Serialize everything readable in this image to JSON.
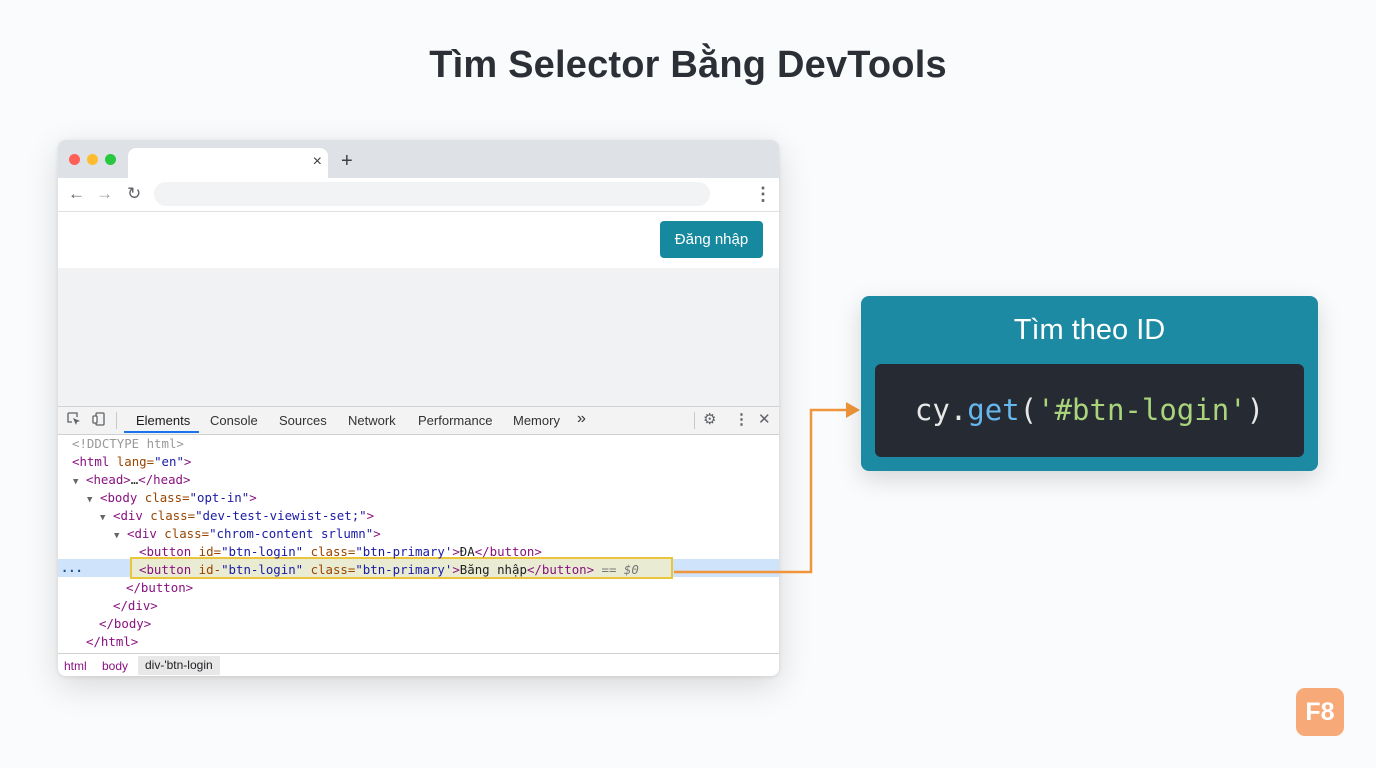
{
  "slide": {
    "title": "Tìm Selector Bằng DevTools"
  },
  "browser": {
    "tab_close_glyph": "×",
    "new_tab_glyph": "+",
    "back_glyph": "←",
    "forward_glyph": "→",
    "reload_glyph": "↻",
    "menu_glyph": "⋮",
    "login_button": "Đăng nhập"
  },
  "devtools": {
    "tabs": [
      "Elements",
      "Console",
      "Sources",
      "Network",
      "Performance",
      "Memory"
    ],
    "more_glyph": "»",
    "gear_glyph": "⚙",
    "menu_glyph": "⋮",
    "close_glyph": "✕",
    "selected_marker": "...",
    "lines": [
      {
        "doctype": "<!DDCTYPE html>"
      },
      {
        "open": "<html",
        "attr": " lang=",
        "val": "\"en\"",
        "close": ">"
      },
      {
        "tri": "▼",
        "open": "<head>",
        "text": "…",
        "close": "</head>"
      },
      {
        "tri": "▼",
        "open": "<body",
        "attr": " class=",
        "val": "\"opt-in\"",
        "close": ">"
      },
      {
        "tri": "▼",
        "open": "<div",
        "attr": " class=",
        "val": "\"dev-test-viewist-set;\"",
        "close": ">"
      },
      {
        "tri": "▼",
        "open": "<div",
        "attr": " class=",
        "val": "\"chrom-content srlumn\"",
        "close": ">"
      },
      {
        "open": "<button",
        "attr": " id=",
        "val": "\"btn-login\"",
        "attr2": " class=",
        "val2": "\"btn-primary'",
        "close": ">",
        "text": "ĐA",
        "end": "</button>"
      },
      {
        "open": "<button",
        "attr": " id-",
        "val": "\"btn-login\"",
        "attr2": " class=",
        "val2": "\"btn-primary'",
        "close": ">",
        "text": "Băng nhập",
        "end": "</button>",
        "eq": " == $0"
      },
      {
        "end": "</button>"
      },
      {
        "end": "</div>"
      },
      {
        "end": "</body>"
      },
      {
        "end": "</html>"
      }
    ],
    "breadcrumbs": [
      "html",
      "body",
      "div-'btn-login"
    ]
  },
  "card": {
    "title": "Tìm theo ID",
    "code_obj": "cy.",
    "code_fn": "get",
    "code_open": "(",
    "code_str": "'#btn-login'",
    "code_close": ")"
  },
  "logo": {
    "text": "F8"
  },
  "colors": {
    "accent": "#17899e",
    "card": "#1c8aa3",
    "connector": "#f0953b",
    "highlight_border": "#eac43a",
    "logo": "#f8a978"
  }
}
